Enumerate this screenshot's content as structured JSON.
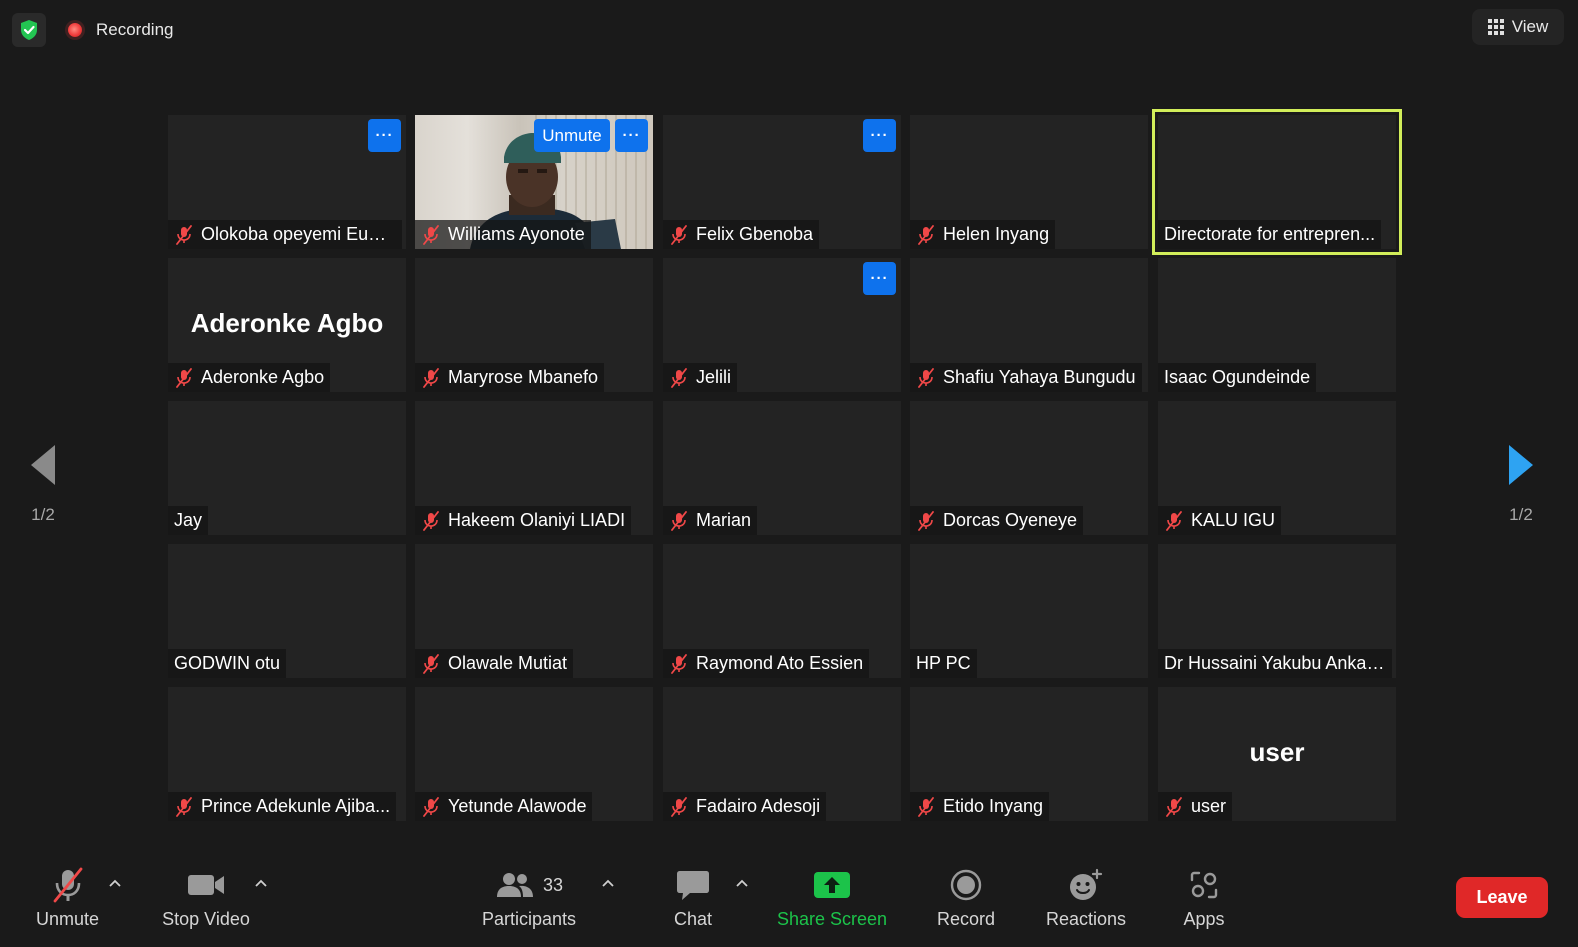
{
  "topbar": {
    "recording_label": "Recording",
    "view_label": "View"
  },
  "tiles": [
    {
      "name": "Olokoba opeyemi Euni...",
      "muted": true
    },
    {
      "name": "Williams Ayonote",
      "muted": true
    },
    {
      "name": "Felix Gbenoba",
      "muted": true
    },
    {
      "name": "Helen Inyang",
      "muted": true
    },
    {
      "name": "Directorate for entrepren...",
      "muted": false
    },
    {
      "name": "Aderonke Agbo",
      "muted": true,
      "big_name": "Aderonke Agbo"
    },
    {
      "name": "Maryrose Mbanefo",
      "muted": true
    },
    {
      "name": "Jelili",
      "muted": true
    },
    {
      "name": "Shafiu Yahaya Bungudu",
      "muted": true
    },
    {
      "name": "Isaac Ogundeinde",
      "muted": false
    },
    {
      "name": "Jay",
      "muted": false
    },
    {
      "name": "Hakeem Olaniyi LIADI",
      "muted": true
    },
    {
      "name": "Marian",
      "muted": true
    },
    {
      "name": "Dorcas Oyeneye",
      "muted": true
    },
    {
      "name": "KALU IGU",
      "muted": true
    },
    {
      "name": "GODWIN otu",
      "muted": false
    },
    {
      "name": "Olawale Mutiat",
      "muted": true
    },
    {
      "name": "Raymond Ato Essien",
      "muted": true
    },
    {
      "name": "HP PC",
      "muted": false
    },
    {
      "name": "Dr Hussaini Yakubu Anka ...",
      "muted": false
    },
    {
      "name": "Prince Adekunle Ajiba...",
      "muted": true
    },
    {
      "name": "Yetunde Alawode",
      "muted": true
    },
    {
      "name": "Fadairo Adesoji",
      "muted": true
    },
    {
      "name": "Etido Inyang",
      "muted": true
    },
    {
      "name": "user",
      "muted": true,
      "big_name": "user"
    }
  ],
  "overlays": {
    "unmute_label": "Unmute",
    "more_label": "···"
  },
  "pager": {
    "left_count": "1/2",
    "right_count": "1/2"
  },
  "toolbar": {
    "unmute_label": "Unmute",
    "stop_video_label": "Stop Video",
    "participants_label": "Participants",
    "participants_count": "33",
    "chat_label": "Chat",
    "share_screen_label": "Share Screen",
    "record_label": "Record",
    "reactions_label": "Reactions",
    "apps_label": "Apps",
    "leave_label": "Leave"
  },
  "colors": {
    "accent_blue": "#0e72ed",
    "active_speaker": "#d2ee5a",
    "share_green": "#1cc34a",
    "leave_red": "#e02828",
    "muted_mic_red": "#f04848",
    "arrow_blue": "#2ea3f2"
  }
}
